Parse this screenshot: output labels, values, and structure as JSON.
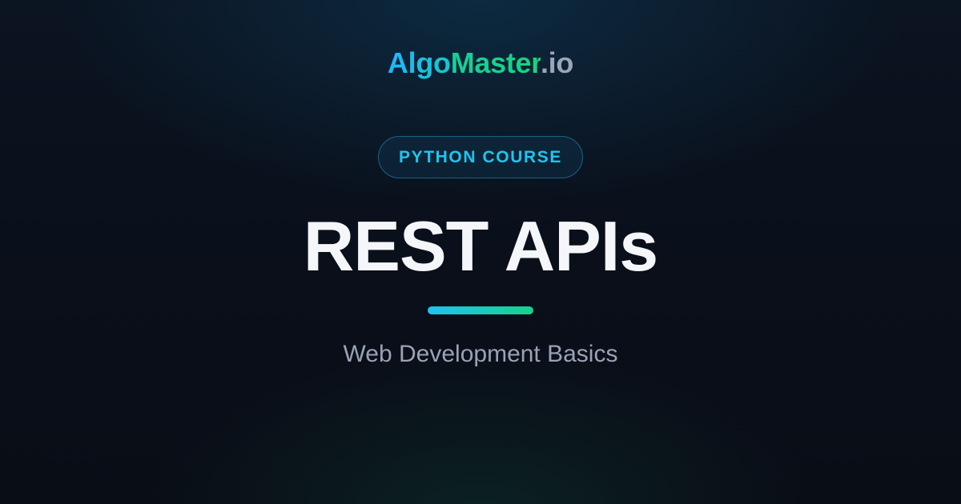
{
  "brand": {
    "part1": "Algo",
    "part2": "Master",
    "part3": ".io",
    "colors": {
      "algo": "#1fb6ff",
      "master": "#16cf9a",
      "suffix": "#9aa6b8"
    }
  },
  "badge": {
    "label": "PYTHON COURSE",
    "color": "#22c4f0"
  },
  "title": "REST APIs",
  "subtitle": "Web Development Basics",
  "accent": {
    "from": "#1ec3f0",
    "to": "#18d28a"
  },
  "background": "#0a0f1a"
}
